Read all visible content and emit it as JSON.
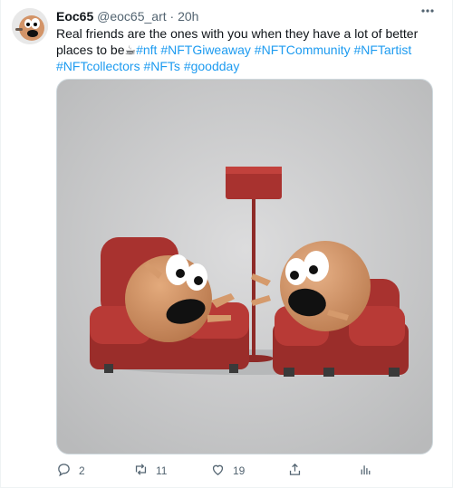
{
  "author": {
    "name": "Eoc65",
    "handle": "@eoc65_art",
    "separator": "·",
    "time": "20h"
  },
  "tweet": {
    "text": "Real friends are the ones with you when they have a lot of better places to be",
    "emoji": "☕",
    "hashtags_line1": [
      "#nft",
      "#NFTGiweaway",
      "#NFTCommunity",
      "#NFTartist"
    ],
    "hashtags_line2": [
      "#NFTcollectors",
      "#NFTs",
      "#goodday"
    ]
  },
  "actions": {
    "reply_count": "2",
    "retweet_count": "11",
    "like_count": "19"
  },
  "icons": {
    "more": "more-dots-icon",
    "reply": "reply-icon",
    "retweet": "retweet-icon",
    "like": "heart-icon",
    "share": "share-icon",
    "analytics": "analytics-icon"
  },
  "colors": {
    "link": "#1d9bf0",
    "muted": "#536471",
    "chair": "#a8322f",
    "character": "#d4976a"
  }
}
